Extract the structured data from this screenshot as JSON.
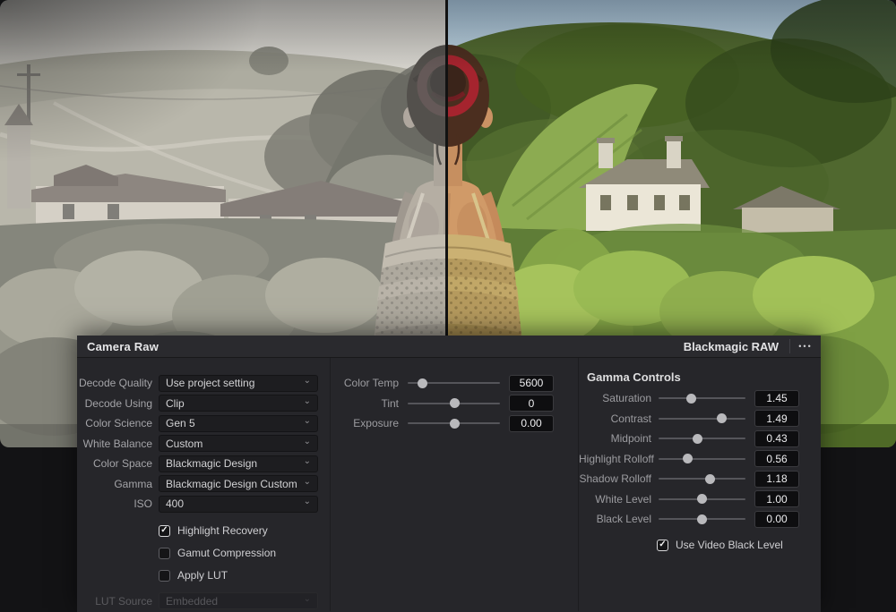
{
  "icons": {
    "chevron_down": "⌄",
    "check": "✓",
    "menu_dots": "•••"
  },
  "colors": {
    "panel_bg": "#26262a",
    "header_bg": "#2a2a2e",
    "field_bg": "#1d1d20",
    "value_bg": "#0e0e10",
    "slider_thumb": "#b9b9bc",
    "scrunchie_red": "#a5242e"
  },
  "panel": {
    "title": "Camera Raw",
    "codec_label": "Blackmagic RAW",
    "decode": {
      "selects": [
        {
          "label": "Decode Quality",
          "value": "Use project setting"
        },
        {
          "label": "Decode Using",
          "value": "Clip"
        },
        {
          "label": "Color Science",
          "value": "Gen 5"
        },
        {
          "label": "White Balance",
          "value": "Custom"
        },
        {
          "label": "Color Space",
          "value": "Blackmagic Design"
        },
        {
          "label": "Gamma",
          "value": "Blackmagic Design Custom"
        },
        {
          "label": "ISO",
          "value": "400"
        }
      ],
      "checkboxes": [
        {
          "label": "Highlight Recovery",
          "checked": true
        },
        {
          "label": "Gamut Compression",
          "checked": false
        },
        {
          "label": "Apply LUT",
          "checked": false
        }
      ],
      "lut_source": {
        "label": "LUT Source",
        "value": "Embedded",
        "disabled": true
      }
    },
    "color_sliders": [
      {
        "label": "Color Temp",
        "value": "5600",
        "pos": 0.12
      },
      {
        "label": "Tint",
        "value": "0",
        "pos": 0.51
      },
      {
        "label": "Exposure",
        "value": "0.00",
        "pos": 0.51
      }
    ],
    "gamma": {
      "header": "Gamma Controls",
      "sliders": [
        {
          "label": "Saturation",
          "value": "1.45",
          "pos": 0.36
        },
        {
          "label": "Contrast",
          "value": "1.49",
          "pos": 0.76
        },
        {
          "label": "Midpoint",
          "value": "0.43",
          "pos": 0.44
        },
        {
          "label": "Highlight Rolloff",
          "value": "0.56",
          "pos": 0.31
        },
        {
          "label": "Shadow Rolloff",
          "value": "1.18",
          "pos": 0.6
        },
        {
          "label": "White Level",
          "value": "1.00",
          "pos": 0.5
        },
        {
          "label": "Black Level",
          "value": "0.00",
          "pos": 0.5
        }
      ],
      "checkbox": {
        "label": "Use Video Black Level",
        "checked": true
      }
    }
  }
}
